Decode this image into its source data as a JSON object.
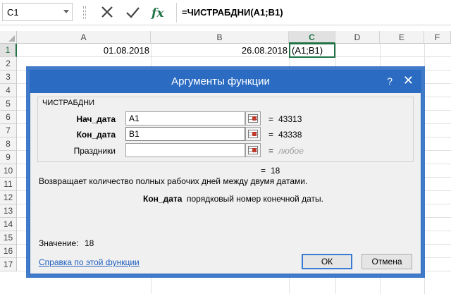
{
  "formula_bar": {
    "name_box": "C1",
    "formula": "=ЧИСТРАБДНИ(A1;B1)"
  },
  "sheet": {
    "columns": [
      "A",
      "B",
      "C",
      "D",
      "E",
      "F"
    ],
    "selected_column": "C",
    "rows": [
      "1",
      "2",
      "3",
      "4",
      "5",
      "6",
      "7",
      "8",
      "9",
      "10",
      "11",
      "12",
      "13",
      "14",
      "15",
      "16",
      "17"
    ],
    "selected_row": "1",
    "cells": {
      "a1": "01.08.2018",
      "b1": "26.08.2018",
      "c1": "(A1;B1)"
    }
  },
  "dialog": {
    "title": "Аргументы функции",
    "help_glyph": "?",
    "close_glyph": "✕",
    "function_name": "ЧИСТРАБДНИ",
    "args": [
      {
        "label": "Нач_дата",
        "input": "A1",
        "value": "43313"
      },
      {
        "label": "Кон_дата",
        "input": "B1",
        "value": "43338"
      },
      {
        "label": "Праздники",
        "input": "",
        "value": "любое"
      }
    ],
    "equals": "=",
    "result_inline": "18",
    "description": "Возвращает количество полных рабочих дней между двумя датами.",
    "arg_description_name": "Кон_дата",
    "arg_description_text": "порядковый номер конечной даты.",
    "value_label": "Значение:",
    "value": "18",
    "help_link": "Справка по этой функции",
    "ok": "ОК",
    "cancel": "Отмена"
  },
  "colors": {
    "excel_green": "#217346",
    "dialog_blue": "#2b6cc2",
    "link": "#1f5fbf"
  }
}
